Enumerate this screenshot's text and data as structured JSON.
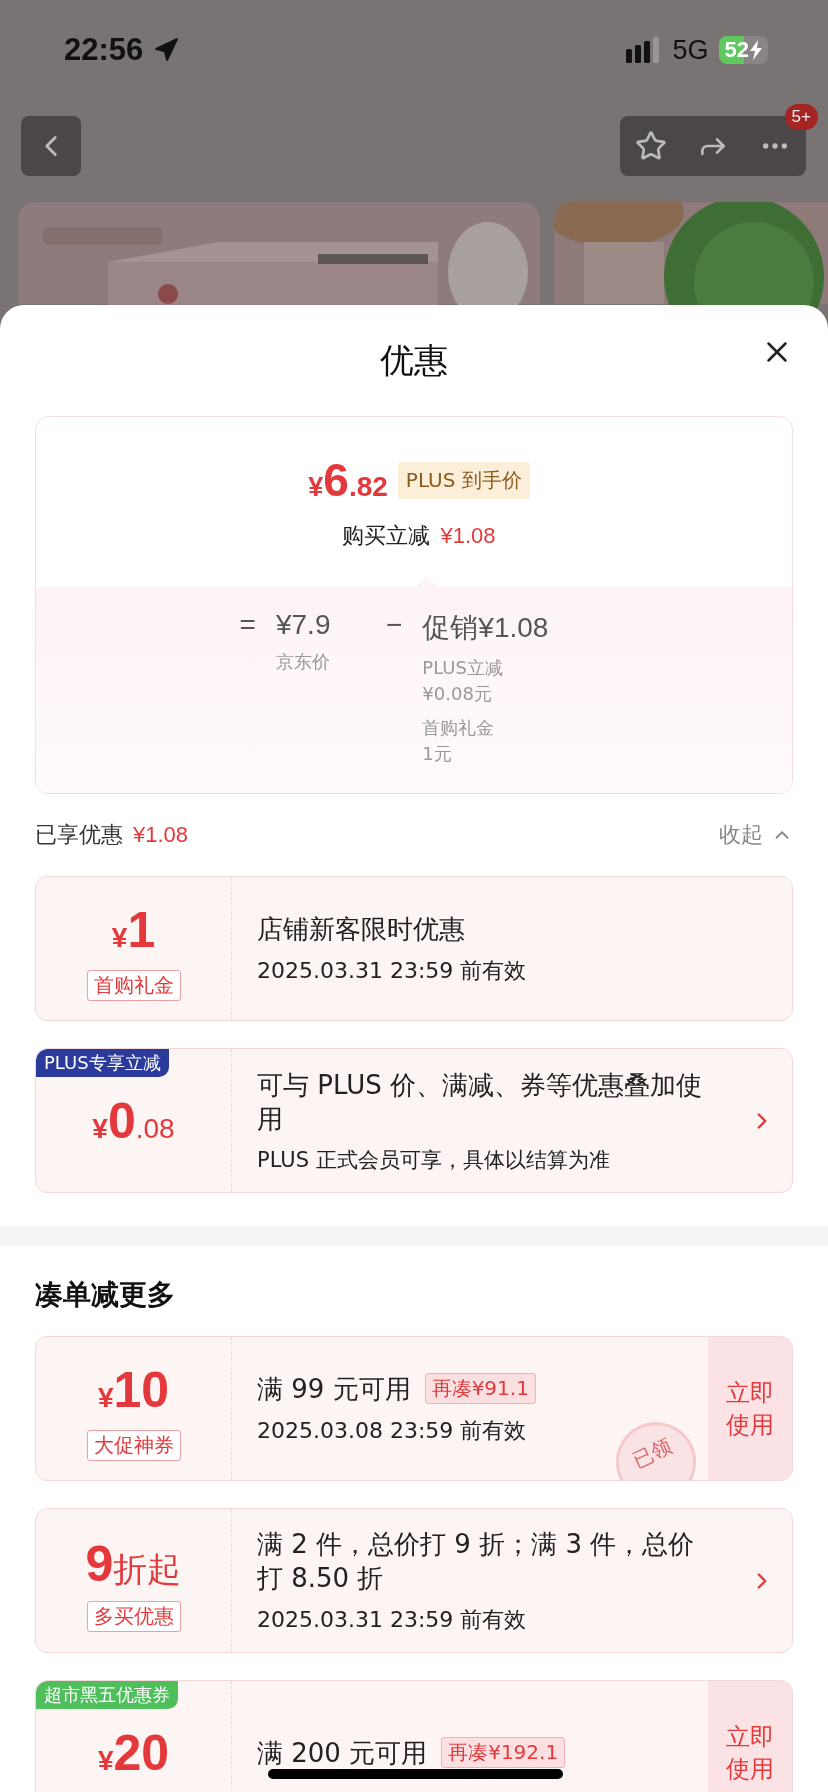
{
  "status_bar": {
    "time": "22:56",
    "network": "5G",
    "battery": "52"
  },
  "nav": {
    "badge": "5+"
  },
  "sheet": {
    "title": "优惠"
  },
  "price_card": {
    "symbol": "¥",
    "price_int": "6",
    "price_dec": ".82",
    "price_tag": "PLUS 到手价",
    "reduction_label": "购买立减",
    "reduction_value": "¥1.08",
    "formula": {
      "equals": "=",
      "base_price": "¥7.9",
      "base_label": "京东价",
      "minus": "−",
      "promo": "促销¥1.08",
      "details": [
        {
          "name": "PLUS立减",
          "value": "¥0.08元"
        },
        {
          "name": "首购礼金",
          "value": "1元"
        }
      ]
    }
  },
  "enjoyed": {
    "label": "已享优惠",
    "value": "¥1.08",
    "toggle": "收起",
    "expanded": true
  },
  "coupons": [
    {
      "symbol": "¥",
      "amount": "1",
      "label": "首购礼金",
      "title": "店铺新客限时优惠",
      "date": "2025.03.31 23:59 前有效"
    },
    {
      "ribbon": "PLUS专享立减",
      "color": "#2a3b9c",
      "symbol": "¥",
      "amount": "0",
      "decimal": ".08",
      "title": "可与 PLUS 价、满减、券等优惠叠加使用",
      "note": "PLUS 正式会员可享，具体以结算为准",
      "action": {
        "kind": "arrow"
      }
    }
  ],
  "more_section": {
    "title": "凑单减更多",
    "coupons": [
      {
        "symbol": "¥",
        "amount": "10",
        "label": "大促神券",
        "title": "满 99 元可用",
        "tag": "再凑¥91.1",
        "date": "2025.03.08 23:59 前有效",
        "action": {
          "kind": "button",
          "label": "立即使用"
        },
        "stamp": "已领"
      },
      {
        "amount": "9",
        "unit": "折起",
        "label": "多买优惠",
        "title": "满 2 件，总价打 9 折；满 3 件，总价打 8.50 折",
        "date": "2025.03.31 23:59 前有效",
        "action": {
          "kind": "arrow"
        }
      },
      {
        "ribbon": "超市黑五优惠券",
        "color": "#4fbf5c",
        "symbol": "¥",
        "amount": "20",
        "title": "满 200 元可用",
        "tag": "再凑¥192.1",
        "action": {
          "kind": "button",
          "label": "立即使用"
        }
      }
    ]
  }
}
